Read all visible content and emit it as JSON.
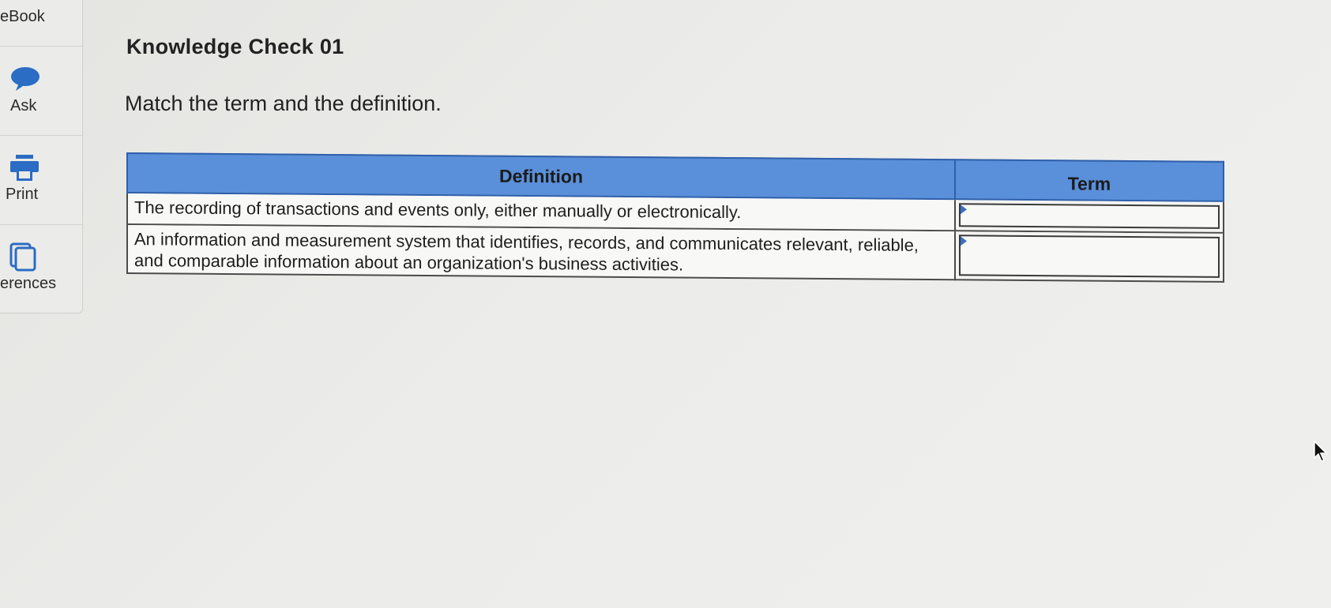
{
  "sidebar": {
    "items": [
      {
        "label": "eBook",
        "icon": "ebook-icon"
      },
      {
        "label": "Ask",
        "icon": "speech-bubble-icon"
      },
      {
        "label": "Print",
        "icon": "printer-icon"
      },
      {
        "label": "erences",
        "icon": "references-icon"
      }
    ]
  },
  "main": {
    "title": "Knowledge Check 01",
    "instruction": "Match the term and the definition."
  },
  "table": {
    "headers": {
      "definition": "Definition",
      "term": "Term"
    },
    "rows": [
      {
        "definition": "The recording of transactions and events only, either manually or electronically.",
        "term_value": ""
      },
      {
        "definition": "An information and measurement system that identifies, records, and communicates relevant, reliable, and comparable information about an organization's business activities.",
        "term_value": ""
      }
    ]
  },
  "colors": {
    "header_bg": "#5a8fd9",
    "accent": "#2f6fc9"
  }
}
